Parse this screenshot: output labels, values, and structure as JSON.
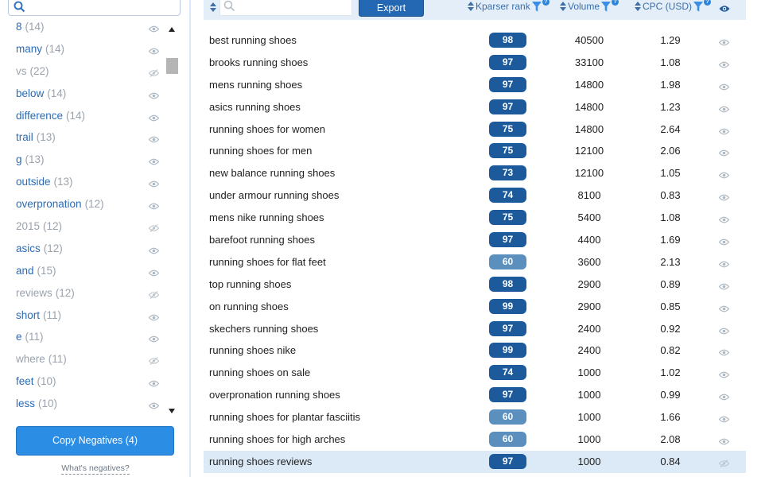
{
  "sidebar": {
    "words": [
      {
        "label": "8",
        "count": "(14)",
        "muted": false,
        "hidden": false
      },
      {
        "label": "many",
        "count": "(14)",
        "muted": false,
        "hidden": false
      },
      {
        "label": "vs",
        "count": "(22)",
        "muted": true,
        "hidden": true
      },
      {
        "label": "below",
        "count": "(14)",
        "muted": false,
        "hidden": false
      },
      {
        "label": "difference",
        "count": "(14)",
        "muted": false,
        "hidden": false
      },
      {
        "label": "trail",
        "count": "(13)",
        "muted": false,
        "hidden": false
      },
      {
        "label": "g",
        "count": "(13)",
        "muted": false,
        "hidden": false
      },
      {
        "label": "outside",
        "count": "(13)",
        "muted": false,
        "hidden": false
      },
      {
        "label": "overpronation",
        "count": "(12)",
        "muted": false,
        "hidden": false
      },
      {
        "label": "2015",
        "count": "(12)",
        "muted": true,
        "hidden": true
      },
      {
        "label": "asics",
        "count": "(12)",
        "muted": false,
        "hidden": false
      },
      {
        "label": "and",
        "count": "(15)",
        "muted": false,
        "hidden": false
      },
      {
        "label": "reviews",
        "count": "(12)",
        "muted": true,
        "hidden": true
      },
      {
        "label": "short",
        "count": "(11)",
        "muted": false,
        "hidden": false
      },
      {
        "label": "e",
        "count": "(11)",
        "muted": false,
        "hidden": false
      },
      {
        "label": "where",
        "count": "(11)",
        "muted": true,
        "hidden": true
      },
      {
        "label": "feet",
        "count": "(10)",
        "muted": false,
        "hidden": false
      },
      {
        "label": "less",
        "count": "(10)",
        "muted": false,
        "hidden": false
      }
    ],
    "copy_negatives_label": "Copy Negatives (4)",
    "whats_negatives_label": "What's negatives?"
  },
  "toolbar": {
    "search_placeholder": "",
    "export_label": "Export",
    "kparser_rank_label": "Kparser rank",
    "volume_label": "Volume",
    "cpc_label": "CPC (USD)",
    "help_glyph": "?"
  },
  "colors": {
    "rank_dark": "#1d5a9c",
    "rank_light": "#5b8fbe",
    "accent": "#2b8de3",
    "link_text": "#2a6cb8"
  },
  "rows": [
    {
      "keyword": "best running shoes",
      "rank": "98",
      "volume": "40500",
      "cpc": "1.29",
      "tone": "dark",
      "hidden": false
    },
    {
      "keyword": "brooks running shoes",
      "rank": "97",
      "volume": "33100",
      "cpc": "1.08",
      "tone": "dark",
      "hidden": false
    },
    {
      "keyword": "mens running shoes",
      "rank": "97",
      "volume": "14800",
      "cpc": "1.98",
      "tone": "dark",
      "hidden": false
    },
    {
      "keyword": "asics running shoes",
      "rank": "97",
      "volume": "14800",
      "cpc": "1.23",
      "tone": "dark",
      "hidden": false
    },
    {
      "keyword": "running shoes for women",
      "rank": "75",
      "volume": "14800",
      "cpc": "2.64",
      "tone": "dark",
      "hidden": false
    },
    {
      "keyword": "running shoes for men",
      "rank": "75",
      "volume": "12100",
      "cpc": "2.06",
      "tone": "dark",
      "hidden": false
    },
    {
      "keyword": "new balance running shoes",
      "rank": "73",
      "volume": "12100",
      "cpc": "1.05",
      "tone": "dark",
      "hidden": false
    },
    {
      "keyword": "under armour running shoes",
      "rank": "74",
      "volume": "8100",
      "cpc": "0.83",
      "tone": "dark",
      "hidden": false
    },
    {
      "keyword": "mens nike running shoes",
      "rank": "75",
      "volume": "5400",
      "cpc": "1.08",
      "tone": "dark",
      "hidden": false
    },
    {
      "keyword": "barefoot running shoes",
      "rank": "97",
      "volume": "4400",
      "cpc": "1.69",
      "tone": "dark",
      "hidden": false
    },
    {
      "keyword": "running shoes for flat feet",
      "rank": "60",
      "volume": "3600",
      "cpc": "2.13",
      "tone": "light",
      "hidden": false
    },
    {
      "keyword": "top running shoes",
      "rank": "98",
      "volume": "2900",
      "cpc": "0.89",
      "tone": "dark",
      "hidden": false
    },
    {
      "keyword": "on running shoes",
      "rank": "99",
      "volume": "2900",
      "cpc": "0.85",
      "tone": "dark",
      "hidden": false
    },
    {
      "keyword": "skechers running shoes",
      "rank": "97",
      "volume": "2400",
      "cpc": "0.92",
      "tone": "dark",
      "hidden": false
    },
    {
      "keyword": "running shoes nike",
      "rank": "99",
      "volume": "2400",
      "cpc": "0.82",
      "tone": "dark",
      "hidden": false
    },
    {
      "keyword": "running shoes on sale",
      "rank": "74",
      "volume": "1000",
      "cpc": "1.02",
      "tone": "dark",
      "hidden": false
    },
    {
      "keyword": "overpronation running shoes",
      "rank": "97",
      "volume": "1000",
      "cpc": "0.99",
      "tone": "dark",
      "hidden": false
    },
    {
      "keyword": "running shoes for plantar fasciitis",
      "rank": "60",
      "volume": "1000",
      "cpc": "1.66",
      "tone": "light",
      "hidden": false
    },
    {
      "keyword": "running shoes for high arches",
      "rank": "60",
      "volume": "1000",
      "cpc": "2.08",
      "tone": "light",
      "hidden": false
    },
    {
      "keyword": "running shoes reviews",
      "rank": "97",
      "volume": "1000",
      "cpc": "0.84",
      "tone": "dark",
      "hidden": true,
      "highlight": true
    }
  ]
}
